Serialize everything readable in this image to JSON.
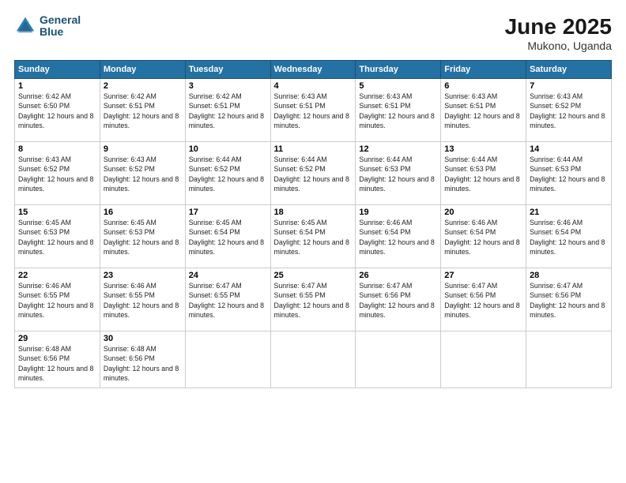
{
  "header": {
    "logo_line1": "General",
    "logo_line2": "Blue",
    "month": "June 2025",
    "location": "Mukono, Uganda"
  },
  "weekdays": [
    "Sunday",
    "Monday",
    "Tuesday",
    "Wednesday",
    "Thursday",
    "Friday",
    "Saturday"
  ],
  "weeks": [
    [
      {
        "day": "1",
        "sunrise": "6:42 AM",
        "sunset": "6:50 PM",
        "daylight": "12 hours and 8 minutes."
      },
      {
        "day": "2",
        "sunrise": "6:42 AM",
        "sunset": "6:51 PM",
        "daylight": "12 hours and 8 minutes."
      },
      {
        "day": "3",
        "sunrise": "6:42 AM",
        "sunset": "6:51 PM",
        "daylight": "12 hours and 8 minutes."
      },
      {
        "day": "4",
        "sunrise": "6:43 AM",
        "sunset": "6:51 PM",
        "daylight": "12 hours and 8 minutes."
      },
      {
        "day": "5",
        "sunrise": "6:43 AM",
        "sunset": "6:51 PM",
        "daylight": "12 hours and 8 minutes."
      },
      {
        "day": "6",
        "sunrise": "6:43 AM",
        "sunset": "6:51 PM",
        "daylight": "12 hours and 8 minutes."
      },
      {
        "day": "7",
        "sunrise": "6:43 AM",
        "sunset": "6:52 PM",
        "daylight": "12 hours and 8 minutes."
      }
    ],
    [
      {
        "day": "8",
        "sunrise": "6:43 AM",
        "sunset": "6:52 PM",
        "daylight": "12 hours and 8 minutes."
      },
      {
        "day": "9",
        "sunrise": "6:43 AM",
        "sunset": "6:52 PM",
        "daylight": "12 hours and 8 minutes."
      },
      {
        "day": "10",
        "sunrise": "6:44 AM",
        "sunset": "6:52 PM",
        "daylight": "12 hours and 8 minutes."
      },
      {
        "day": "11",
        "sunrise": "6:44 AM",
        "sunset": "6:52 PM",
        "daylight": "12 hours and 8 minutes."
      },
      {
        "day": "12",
        "sunrise": "6:44 AM",
        "sunset": "6:53 PM",
        "daylight": "12 hours and 8 minutes."
      },
      {
        "day": "13",
        "sunrise": "6:44 AM",
        "sunset": "6:53 PM",
        "daylight": "12 hours and 8 minutes."
      },
      {
        "day": "14",
        "sunrise": "6:44 AM",
        "sunset": "6:53 PM",
        "daylight": "12 hours and 8 minutes."
      }
    ],
    [
      {
        "day": "15",
        "sunrise": "6:45 AM",
        "sunset": "6:53 PM",
        "daylight": "12 hours and 8 minutes."
      },
      {
        "day": "16",
        "sunrise": "6:45 AM",
        "sunset": "6:53 PM",
        "daylight": "12 hours and 8 minutes."
      },
      {
        "day": "17",
        "sunrise": "6:45 AM",
        "sunset": "6:54 PM",
        "daylight": "12 hours and 8 minutes."
      },
      {
        "day": "18",
        "sunrise": "6:45 AM",
        "sunset": "6:54 PM",
        "daylight": "12 hours and 8 minutes."
      },
      {
        "day": "19",
        "sunrise": "6:46 AM",
        "sunset": "6:54 PM",
        "daylight": "12 hours and 8 minutes."
      },
      {
        "day": "20",
        "sunrise": "6:46 AM",
        "sunset": "6:54 PM",
        "daylight": "12 hours and 8 minutes."
      },
      {
        "day": "21",
        "sunrise": "6:46 AM",
        "sunset": "6:54 PM",
        "daylight": "12 hours and 8 minutes."
      }
    ],
    [
      {
        "day": "22",
        "sunrise": "6:46 AM",
        "sunset": "6:55 PM",
        "daylight": "12 hours and 8 minutes."
      },
      {
        "day": "23",
        "sunrise": "6:46 AM",
        "sunset": "6:55 PM",
        "daylight": "12 hours and 8 minutes."
      },
      {
        "day": "24",
        "sunrise": "6:47 AM",
        "sunset": "6:55 PM",
        "daylight": "12 hours and 8 minutes."
      },
      {
        "day": "25",
        "sunrise": "6:47 AM",
        "sunset": "6:55 PM",
        "daylight": "12 hours and 8 minutes."
      },
      {
        "day": "26",
        "sunrise": "6:47 AM",
        "sunset": "6:56 PM",
        "daylight": "12 hours and 8 minutes."
      },
      {
        "day": "27",
        "sunrise": "6:47 AM",
        "sunset": "6:56 PM",
        "daylight": "12 hours and 8 minutes."
      },
      {
        "day": "28",
        "sunrise": "6:47 AM",
        "sunset": "6:56 PM",
        "daylight": "12 hours and 8 minutes."
      }
    ],
    [
      {
        "day": "29",
        "sunrise": "6:48 AM",
        "sunset": "6:56 PM",
        "daylight": "12 hours and 8 minutes."
      },
      {
        "day": "30",
        "sunrise": "6:48 AM",
        "sunset": "6:56 PM",
        "daylight": "12 hours and 8 minutes."
      },
      null,
      null,
      null,
      null,
      null
    ]
  ]
}
